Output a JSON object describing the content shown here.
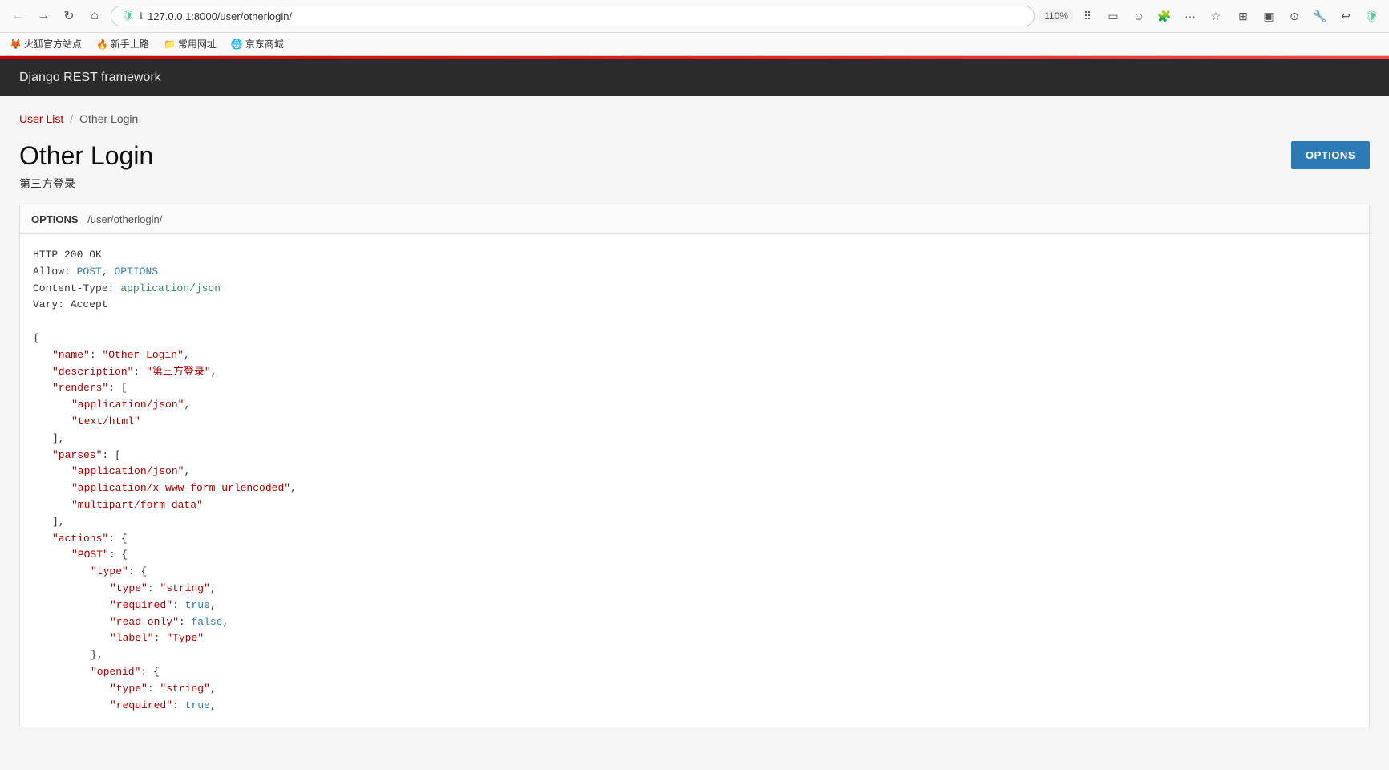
{
  "browser": {
    "url": "127.0.0.1:8000/user/otherlogin/",
    "zoom": "110%",
    "bookmarks": [
      {
        "label": "火狐官方站点",
        "icon": "🦊"
      },
      {
        "label": "新手上路",
        "icon": "🔥"
      },
      {
        "label": "常用网址",
        "icon": "📁"
      },
      {
        "label": "京东商城",
        "icon": "🌐"
      }
    ]
  },
  "drf": {
    "header_title": "Django REST framework"
  },
  "breadcrumb": {
    "link_label": "User List",
    "separator": "/",
    "current": "Other Login"
  },
  "page": {
    "title": "Other Login",
    "subtitle": "第三方登录",
    "options_button_label": "OPTIONS"
  },
  "response": {
    "method": "OPTIONS",
    "path": "/user/otherlogin/",
    "status_line": "HTTP 200 OK",
    "headers": [
      {
        "name": "Allow:",
        "value": "POST, OPTIONS",
        "value_type": "blue"
      },
      {
        "name": "Content-Type:",
        "value": "application/json",
        "value_type": "green"
      },
      {
        "name": "Vary:",
        "value": "Accept",
        "value_type": "normal"
      }
    ],
    "json_name": "\"Other Login\"",
    "json_description": "\"第三方登录\"",
    "renders": [
      "\"application/json\"",
      "\"text/html\""
    ],
    "parses": [
      "\"application/json\"",
      "\"application/x-www-form-urlencoded\"",
      "\"multipart/form-data\""
    ],
    "actions": {
      "POST": {
        "type_field": {
          "type": "\"string\"",
          "required": "true",
          "read_only": "false",
          "label": "\"Type\""
        },
        "openid_field": {
          "type": "\"string\"",
          "required": "true"
        }
      }
    }
  }
}
